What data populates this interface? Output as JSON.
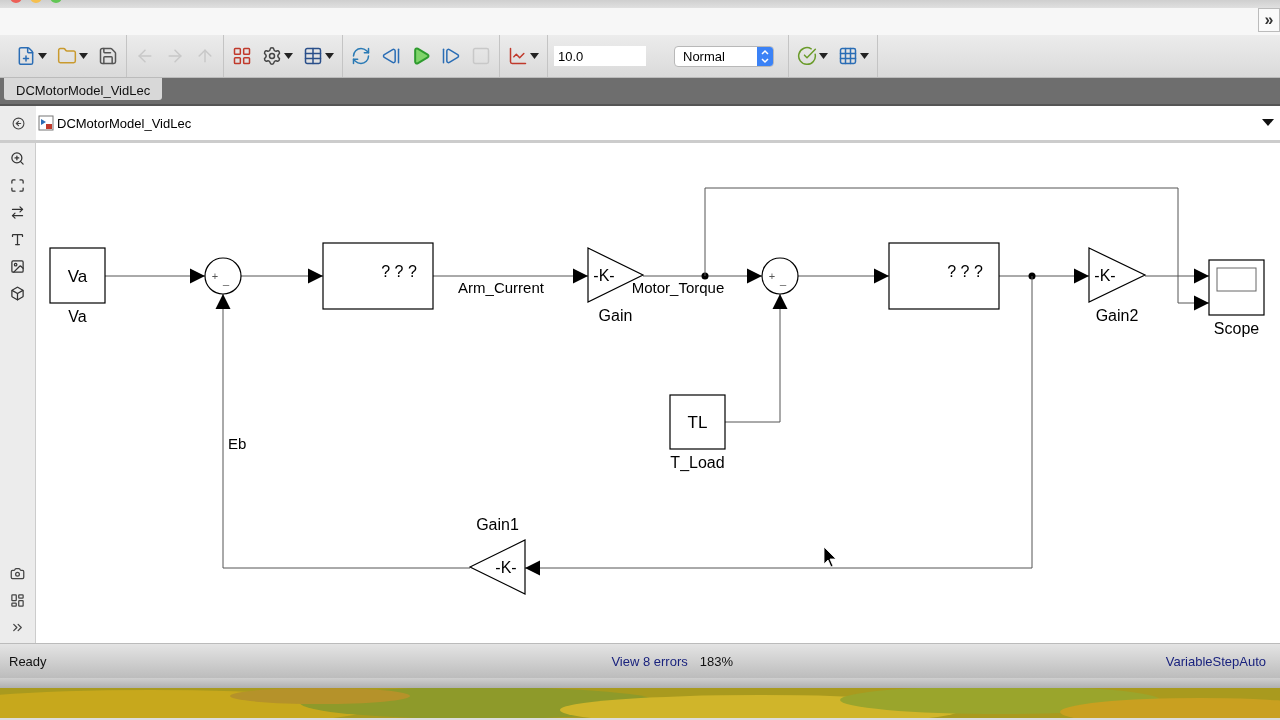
{
  "window": {
    "overflow_button": "»"
  },
  "toolbar": {
    "groups": [
      [
        {
          "kind": "new",
          "dropdown": true,
          "disabled": false
        },
        {
          "kind": "open",
          "dropdown": true,
          "disabled": false
        },
        {
          "kind": "save",
          "dropdown": false,
          "disabled": false
        }
      ],
      [
        {
          "kind": "back",
          "dropdown": false,
          "disabled": true
        },
        {
          "kind": "forward",
          "dropdown": false,
          "disabled": true
        },
        {
          "kind": "up",
          "dropdown": false,
          "disabled": true
        }
      ],
      [
        {
          "kind": "library",
          "dropdown": false,
          "disabled": false
        },
        {
          "kind": "settings",
          "dropdown": true,
          "disabled": false
        },
        {
          "kind": "explorer",
          "dropdown": true,
          "disabled": false
        }
      ],
      [
        {
          "kind": "update",
          "dropdown": false,
          "disabled": false
        },
        {
          "kind": "step_back",
          "dropdown": false,
          "disabled": false
        },
        {
          "kind": "run",
          "dropdown": false,
          "disabled": false
        },
        {
          "kind": "step_forward",
          "dropdown": false,
          "disabled": false
        },
        {
          "kind": "stop",
          "dropdown": false,
          "disabled": true
        }
      ],
      [
        {
          "kind": "viewer",
          "dropdown": true,
          "disabled": false
        }
      ]
    ],
    "stop_time": "10.0",
    "mode": "Normal",
    "tail": [
      {
        "kind": "check",
        "dropdown": true,
        "disabled": false
      },
      {
        "kind": "grid",
        "dropdown": true,
        "disabled": false
      }
    ]
  },
  "tabs": [
    {
      "label": "DCMotorModel_VidLec",
      "selected": true
    }
  ],
  "breadcrumb": {
    "label": "DCMotorModel_VidLec"
  },
  "diagram": {
    "blocks": [
      {
        "kind": "constant",
        "text": "Va",
        "name": "Va"
      },
      {
        "kind": "sum",
        "signs": [
          "+",
          "_"
        ]
      },
      {
        "kind": "subsystem",
        "text": "? ? ?"
      },
      {
        "kind": "gain",
        "text": "-K-",
        "name": "Gain"
      },
      {
        "kind": "sum",
        "signs": [
          "+",
          "_"
        ]
      },
      {
        "kind": "subsystem",
        "text": "? ? ?"
      },
      {
        "kind": "gain",
        "text": "-K-",
        "name": "Gain2"
      },
      {
        "kind": "scope",
        "name": "Scope"
      },
      {
        "kind": "constant",
        "text": "TL",
        "name": "T_Load"
      },
      {
        "kind": "gain",
        "text": "-K-",
        "name": "Gain1"
      }
    ],
    "signals": [
      {
        "label": "Arm_Current"
      },
      {
        "label": "Motor_Torque"
      },
      {
        "label": "Eb"
      }
    ]
  },
  "status_bar": {
    "status": "Ready",
    "errors_link": "View 8 errors",
    "zoom": "183%",
    "solver": "VariableStepAuto"
  }
}
